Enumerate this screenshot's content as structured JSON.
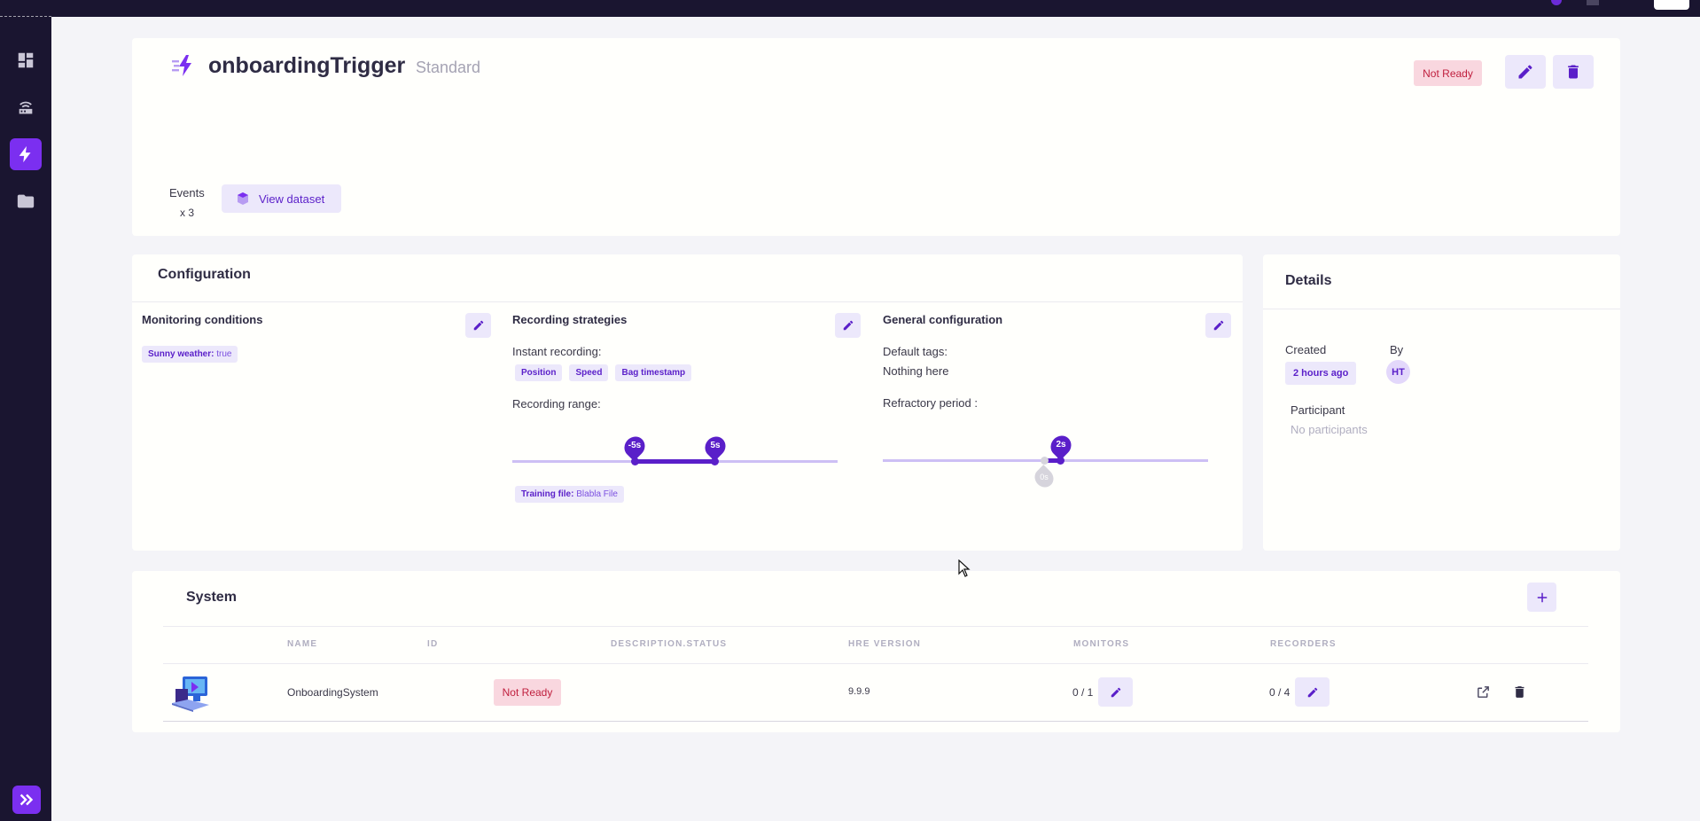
{
  "trigger": {
    "name": "onboardingTrigger",
    "type": "Standard",
    "status": "Not Ready",
    "events_label": "Events",
    "events_count": "x 3",
    "view_dataset_label": "View dataset"
  },
  "configuration": {
    "title": "Configuration",
    "monitoring": {
      "title": "Monitoring conditions",
      "condition_key": "Sunny weather:",
      "condition_value": "true"
    },
    "recording": {
      "title": "Recording strategies",
      "instant_label": "Instant recording:",
      "instant_tags": [
        "Position",
        "Speed",
        "Bag timestamp"
      ],
      "range_label": "Recording range:",
      "range_min_label": "-5s",
      "range_max_label": "5s",
      "training_key": "Training file:",
      "training_value": "Blabla File"
    },
    "general": {
      "title": "General configuration",
      "default_tags_label": "Default tags:",
      "default_tags_value": "Nothing here",
      "refractory_label": "Refractory period :",
      "refractory_value_label": "2s",
      "refractory_zero_label": "0s"
    }
  },
  "details": {
    "title": "Details",
    "created_label": "Created",
    "created_value": "2 hours ago",
    "by_label": "By",
    "by_initials": "HT",
    "participant_label": "Participant",
    "participant_value": "No participants"
  },
  "system": {
    "title": "System",
    "columns": [
      "NAME",
      "ID",
      "DESCRIPTION.STATUS",
      "HRE VERSION",
      "MONITORS",
      "RECORDERS"
    ],
    "rows": [
      {
        "name": "OnboardingSystem",
        "id": "",
        "status": "Not Ready",
        "hre_version": "9.9.9",
        "monitors": "0 / 1",
        "recorders": "0 / 4"
      }
    ]
  },
  "colors": {
    "accent": "#7b2ff0",
    "sidebar": "#1a1530",
    "status_bg": "#f9d7df",
    "status_text": "#c0203f"
  },
  "icons": {
    "sidebar": [
      "dashboard-icon",
      "router-icon",
      "bolt-icon",
      "folder-icon",
      "expand-icon"
    ]
  }
}
